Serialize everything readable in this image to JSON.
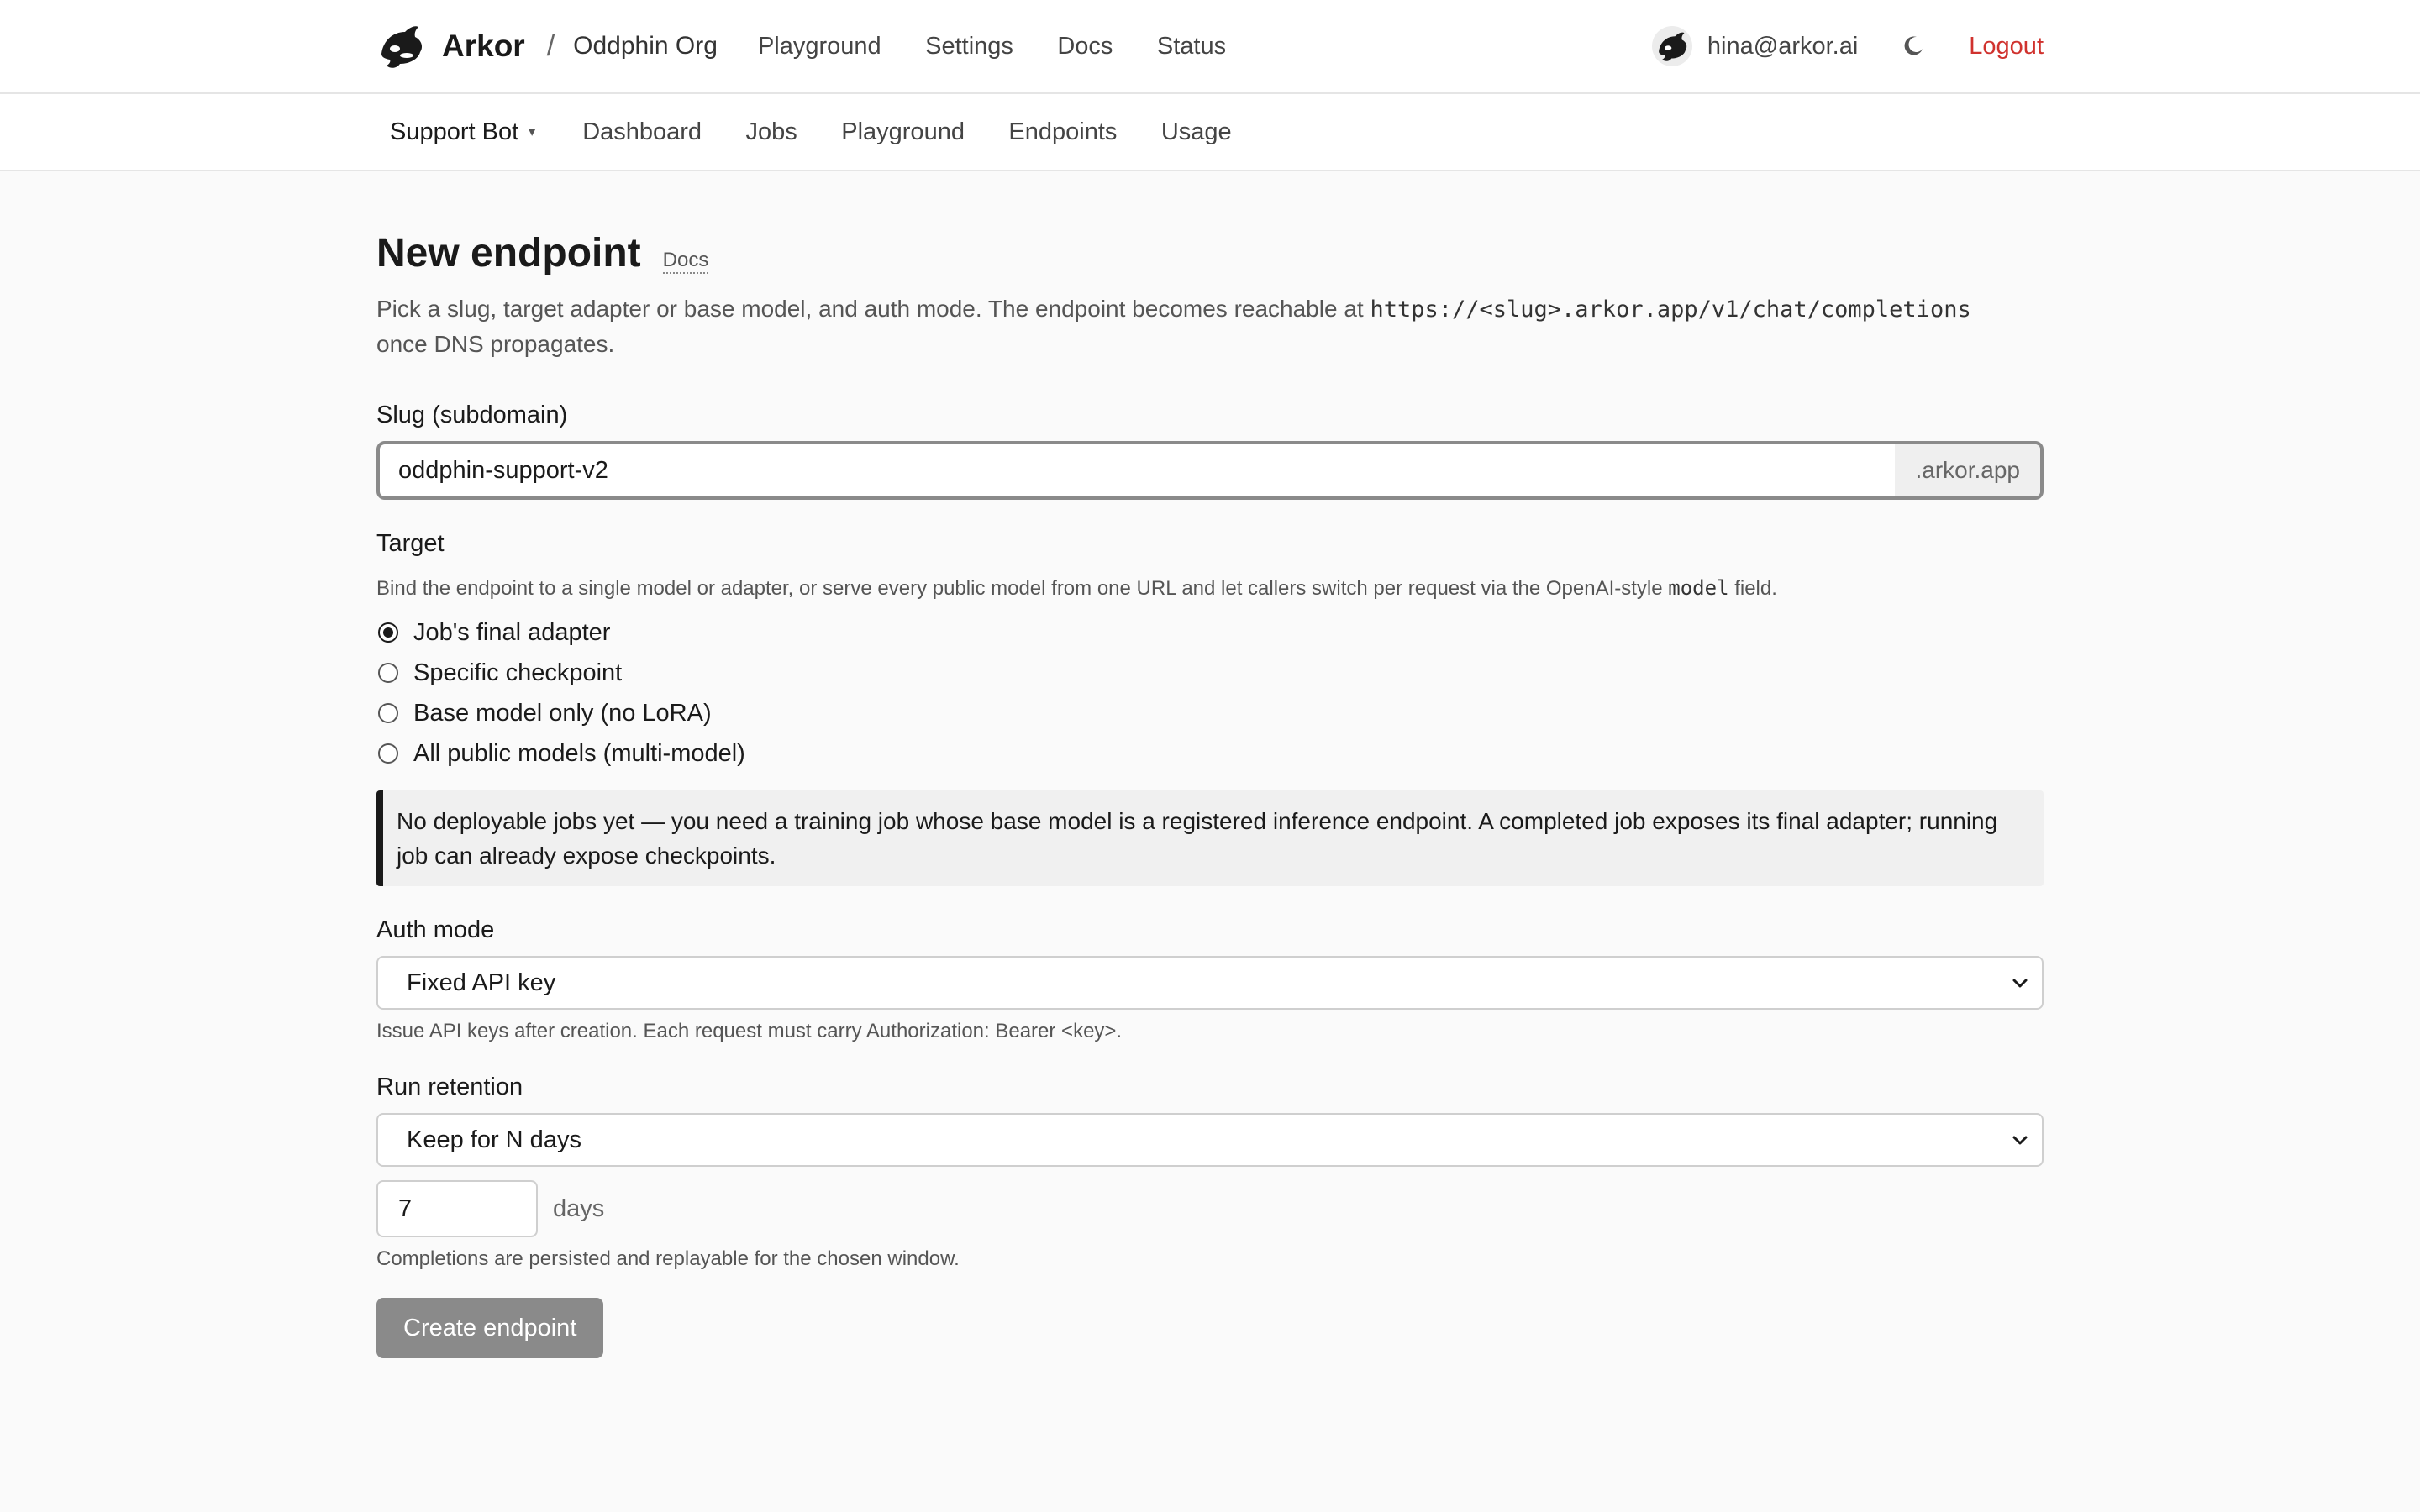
{
  "header": {
    "brand": "Arkor",
    "separator": "/",
    "org": "Oddphin Org",
    "nav": [
      "Playground",
      "Settings",
      "Docs",
      "Status"
    ],
    "user_email": "hina@arkor.ai",
    "logout_label": "Logout"
  },
  "subnav": {
    "project": "Support Bot",
    "caret": "▾",
    "items": [
      "Dashboard",
      "Jobs",
      "Playground",
      "Endpoints",
      "Usage"
    ]
  },
  "page": {
    "title": "New endpoint",
    "docs_label": "Docs",
    "intro_text": "Pick a slug, target adapter or base model, and auth mode. The endpoint becomes reachable at",
    "intro_url": "https://<slug>.arkor.app/v1/chat/completions",
    "intro_tail": "once DNS propagates."
  },
  "slug": {
    "label": "Slug (subdomain)",
    "value": "oddphin-support-v2",
    "suffix": ".arkor.app"
  },
  "target": {
    "label": "Target",
    "hint_pre": "Bind the endpoint to a single model or adapter, or serve every public model from one URL and let callers switch per request via the OpenAI-style",
    "hint_code": "model",
    "hint_post": "field.",
    "options": [
      {
        "label": "Job's final adapter",
        "checked": true
      },
      {
        "label": "Specific checkpoint",
        "checked": false
      },
      {
        "label": "Base model only (no LoRA)",
        "checked": false
      },
      {
        "label": "All public models (multi-model)",
        "checked": false
      }
    ],
    "notice": "No deployable jobs yet — you need a training job whose base model is a registered inference endpoint. A completed job exposes its final adapter; running job can already expose checkpoints."
  },
  "auth": {
    "label": "Auth mode",
    "selected": "Fixed API key",
    "hint": "Issue API keys after creation. Each request must carry Authorization: Bearer <key>."
  },
  "retention": {
    "label": "Run retention",
    "selected": "Keep for N days",
    "days_value": "7",
    "days_unit": "days",
    "hint": "Completions are persisted and replayable for the chosen window."
  },
  "submit_label": "Create endpoint"
}
